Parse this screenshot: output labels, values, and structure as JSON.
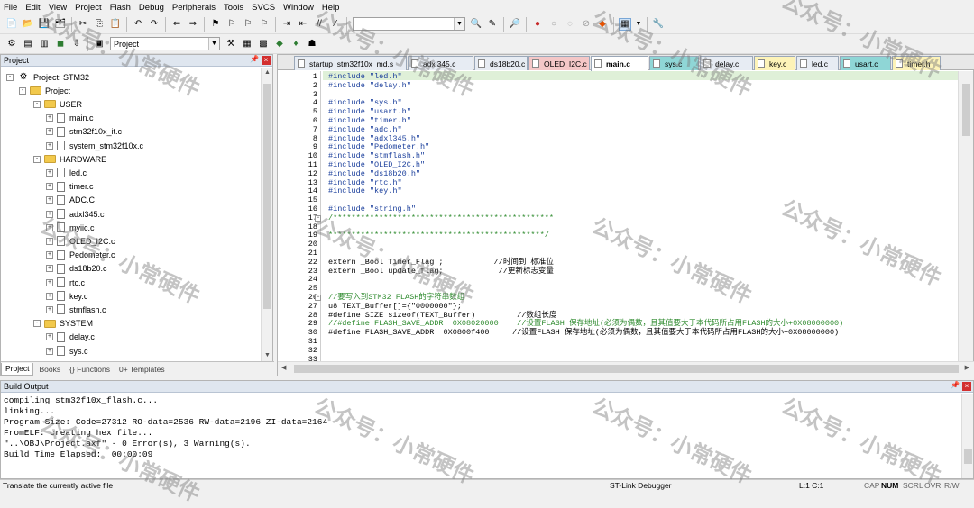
{
  "menu": [
    "File",
    "Edit",
    "View",
    "Project",
    "Flash",
    "Debug",
    "Peripherals",
    "Tools",
    "SVCS",
    "Window",
    "Help"
  ],
  "toolbar": {
    "target_dropdown": "Project"
  },
  "project_panel": {
    "title": "Project",
    "tree": [
      {
        "label": "Project: STM32",
        "level": 0,
        "kind": "project",
        "expand": "-"
      },
      {
        "label": "Project",
        "level": 1,
        "kind": "folder",
        "expand": "-"
      },
      {
        "label": "USER",
        "level": 2,
        "kind": "folder",
        "expand": "-"
      },
      {
        "label": "main.c",
        "level": 3,
        "kind": "file",
        "expand": "+"
      },
      {
        "label": "stm32f10x_it.c",
        "level": 3,
        "kind": "file",
        "expand": "+"
      },
      {
        "label": "system_stm32f10x.c",
        "level": 3,
        "kind": "file",
        "expand": "+"
      },
      {
        "label": "HARDWARE",
        "level": 2,
        "kind": "folder",
        "expand": "-"
      },
      {
        "label": "led.c",
        "level": 3,
        "kind": "file",
        "expand": "+"
      },
      {
        "label": "timer.c",
        "level": 3,
        "kind": "file",
        "expand": "+"
      },
      {
        "label": "ADC.C",
        "level": 3,
        "kind": "file",
        "expand": "+"
      },
      {
        "label": "adxl345.c",
        "level": 3,
        "kind": "file",
        "expand": "+"
      },
      {
        "label": "myiic.c",
        "level": 3,
        "kind": "file",
        "expand": "+"
      },
      {
        "label": "OLED_I2C.c",
        "level": 3,
        "kind": "file",
        "expand": "+"
      },
      {
        "label": "Pedometer.c",
        "level": 3,
        "kind": "file",
        "expand": "+"
      },
      {
        "label": "ds18b20.c",
        "level": 3,
        "kind": "file",
        "expand": "+"
      },
      {
        "label": "rtc.c",
        "level": 3,
        "kind": "file",
        "expand": "+"
      },
      {
        "label": "key.c",
        "level": 3,
        "kind": "file",
        "expand": "+"
      },
      {
        "label": "stmflash.c",
        "level": 3,
        "kind": "file",
        "expand": "+"
      },
      {
        "label": "SYSTEM",
        "level": 2,
        "kind": "folder",
        "expand": "-"
      },
      {
        "label": "delay.c",
        "level": 3,
        "kind": "file",
        "expand": "+"
      },
      {
        "label": "sys.c",
        "level": 3,
        "kind": "file",
        "expand": "+"
      }
    ],
    "bottom_tabs": [
      "Project",
      "Books",
      "{} Functions",
      "0+ Templates"
    ]
  },
  "editor": {
    "tabs": [
      {
        "label": "startup_stm32f10x_md.s",
        "color": "#e7ecf3"
      },
      {
        "label": "adxl345.c",
        "color": "#e7ecf3"
      },
      {
        "label": "ds18b20.c",
        "color": "#e7ecf3"
      },
      {
        "label": "OLED_I2C.c",
        "color": "#f4c7c7"
      },
      {
        "label": "main.c",
        "color": "#ffffff"
      },
      {
        "label": "sys.c",
        "color": "#8fd6d6"
      },
      {
        "label": "delay.c",
        "color": "#e7ecf3"
      },
      {
        "label": "key.c",
        "color": "#fdf3b8"
      },
      {
        "label": "led.c",
        "color": "#e7ecf3"
      },
      {
        "label": "usart.c",
        "color": "#8fd6d6"
      },
      {
        "label": "timer.h",
        "color": "#fdf3b8"
      }
    ],
    "lines": [
      {
        "n": "1",
        "t": "#include \"led.h\"",
        "c": "pp"
      },
      {
        "n": "2",
        "t": "#include \"delay.h\"",
        "c": "pp"
      },
      {
        "n": "3",
        "t": "",
        "c": "pl"
      },
      {
        "n": "4",
        "t": "#include \"sys.h\"",
        "c": "pp"
      },
      {
        "n": "5",
        "t": "#include \"usart.h\"",
        "c": "pp"
      },
      {
        "n": "6",
        "t": "#include \"timer.h\"",
        "c": "pp"
      },
      {
        "n": "7",
        "t": "#include \"adc.h\"",
        "c": "pp"
      },
      {
        "n": "8",
        "t": "#include \"adxl345.h\"",
        "c": "pp"
      },
      {
        "n": "9",
        "t": "#include \"Pedometer.h\"",
        "c": "pp"
      },
      {
        "n": "10",
        "t": "#include \"stmflash.h\"",
        "c": "pp"
      },
      {
        "n": "11",
        "t": "#include \"OLED_I2C.h\"",
        "c": "pp"
      },
      {
        "n": "12",
        "t": "#include \"ds18b20.h\"",
        "c": "pp"
      },
      {
        "n": "13",
        "t": "#include \"rtc.h\"",
        "c": "pp"
      },
      {
        "n": "14",
        "t": "#include \"key.h\"",
        "c": "pp"
      },
      {
        "n": "15",
        "t": "",
        "c": "pl"
      },
      {
        "n": "16",
        "t": "#include \"string.h\"",
        "c": "pp"
      },
      {
        "n": "17",
        "t": "/************************************************",
        "c": "cm"
      },
      {
        "n": "18",
        "t": "",
        "c": "pl"
      },
      {
        "n": "19",
        "t": "***********************************************/",
        "c": "cm"
      },
      {
        "n": "20",
        "t": "",
        "c": "pl"
      },
      {
        "n": "21",
        "t": "",
        "c": "pl"
      },
      {
        "n": "22",
        "t": "extern _Bool Timer_Flag ;           //时间到 标准位",
        "c": "pl"
      },
      {
        "n": "23",
        "t": "extern _Bool update_flag;            //更新标志变量",
        "c": "pl"
      },
      {
        "n": "24",
        "t": "",
        "c": "pl"
      },
      {
        "n": "25",
        "t": "",
        "c": "pl"
      },
      {
        "n": "26",
        "t": "//要写入到STM32 FLASH的字符串数组",
        "c": "cm"
      },
      {
        "n": "27",
        "t": "u8 TEXT_Buffer[]={\"0000000\"};",
        "c": "pl"
      },
      {
        "n": "28",
        "t": "#define SIZE sizeof(TEXT_Buffer)         //数组长度",
        "c": "pl"
      },
      {
        "n": "29",
        "t": "//#define FLASH_SAVE_ADDR  0X08020000    //设置FLASH 保存地址(必须为偶数，且其值要大于本代码所占用FLASH的大小+0X08000000)",
        "c": "cm"
      },
      {
        "n": "30",
        "t": "#define FLASH_SAVE_ADDR  0X0800f400     //设置FLASH 保存地址(必须为偶数，且其值要大于本代码所占用FLASH的大小+0X08000000)",
        "c": "pl"
      },
      {
        "n": "31",
        "t": "",
        "c": "pl"
      },
      {
        "n": "32",
        "t": "",
        "c": "pl"
      },
      {
        "n": "33",
        "t": "",
        "c": "pl"
      }
    ]
  },
  "build_output": {
    "title": "Build Output",
    "lines": [
      "compiling stm32f10x_flash.c...",
      "linking...",
      "Program Size: Code=27312 RO-data=2536 RW-data=2196 ZI-data=2164",
      "FromELF: creating hex file...",
      "\"..\\OBJ\\Project.axf\" - 0 Error(s), 3 Warning(s).",
      "Build Time Elapsed:  00:00:09"
    ]
  },
  "status_bar": {
    "hint": "Translate the currently active file",
    "debugger": "ST-Link Debugger",
    "position": "L:1 C:1",
    "caps": "CAP",
    "num": "NUM",
    "scrl": "SCRL",
    "ovr": "OVR",
    "rw": "R/W"
  },
  "watermark": "公众号：小常硬件"
}
